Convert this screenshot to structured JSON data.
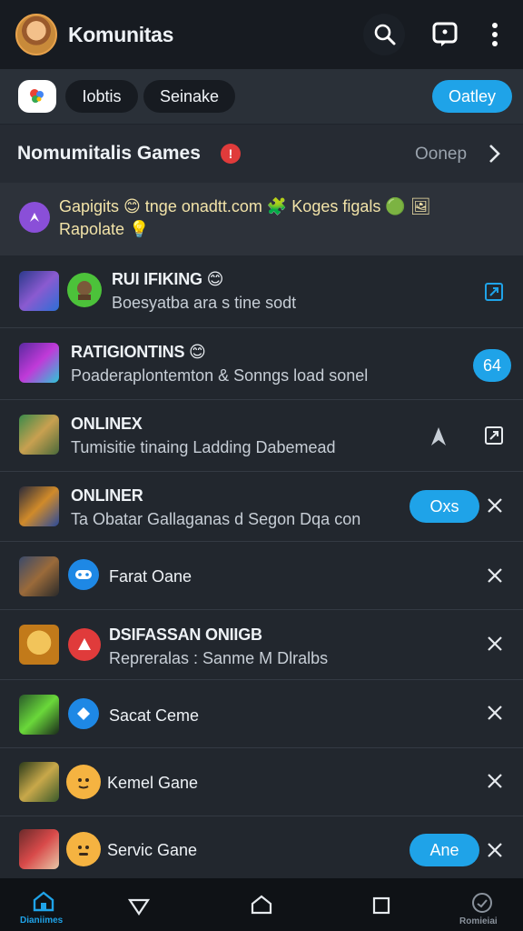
{
  "header": {
    "title": "Komunitas",
    "icons": [
      "avatar",
      "search-icon",
      "chat-icon",
      "more-vertical-icon"
    ]
  },
  "filters": {
    "app_icon": "google-app-icon",
    "chips": [
      "Iobtis",
      "Seinake"
    ],
    "active_chip": "Oatley",
    "accent_color": "#1fa3e8"
  },
  "section": {
    "title": "Nomumitalis Games",
    "badge": "!",
    "more_label": "Oonep"
  },
  "notice": {
    "line1": "Gapigits 😊 tnge onadtt.com 🧩 Koges figals 🟢 🖼",
    "line2": "Rapolate 💡"
  },
  "rows": [
    {
      "title": "RUI IFIKING 😊",
      "subtitle": "Boesyatba ara s tine sodt",
      "action_icon": "external-link-icon"
    },
    {
      "title": "RATIGIONTINS 😊",
      "subtitle": "Poaderaplontemton & Sonngs load sonel",
      "action_label": "64"
    },
    {
      "title": "ONLINEX",
      "subtitle": "Tumisitie tinaing Ladding Dabemead",
      "extra_icon": "send-icon",
      "action_icon": "external-link-icon"
    },
    {
      "title": "ONLINER",
      "subtitle": "Ta Obatar Gallaganas d Segon Dqa con",
      "action_label": "Oxs",
      "close_icon": "close-icon"
    },
    {
      "title": "Farat Oane",
      "avatar_icon": "game-controller-icon",
      "close_icon": "close-icon"
    },
    {
      "title": "DSIFASSAN ONIIGB",
      "subtitle": "Repreralas : Sanme M Dlralbs",
      "avatar_icon": "alert-icon",
      "close_icon": "close-icon"
    },
    {
      "title": "Sacat Ceme",
      "avatar_icon": "game-controller-icon",
      "close_icon": "close-icon"
    },
    {
      "title": "Kemel Gane",
      "avatar_icon": "emoji-face-icon",
      "close_icon": "close-icon"
    },
    {
      "title": "Servic Gane",
      "avatar_icon": "emoji-face-icon",
      "action_label": "Ane",
      "close_icon": "close-icon"
    }
  ],
  "bottom_nav": {
    "home_label": "Dianiimes",
    "right_label": "Romieiai"
  }
}
